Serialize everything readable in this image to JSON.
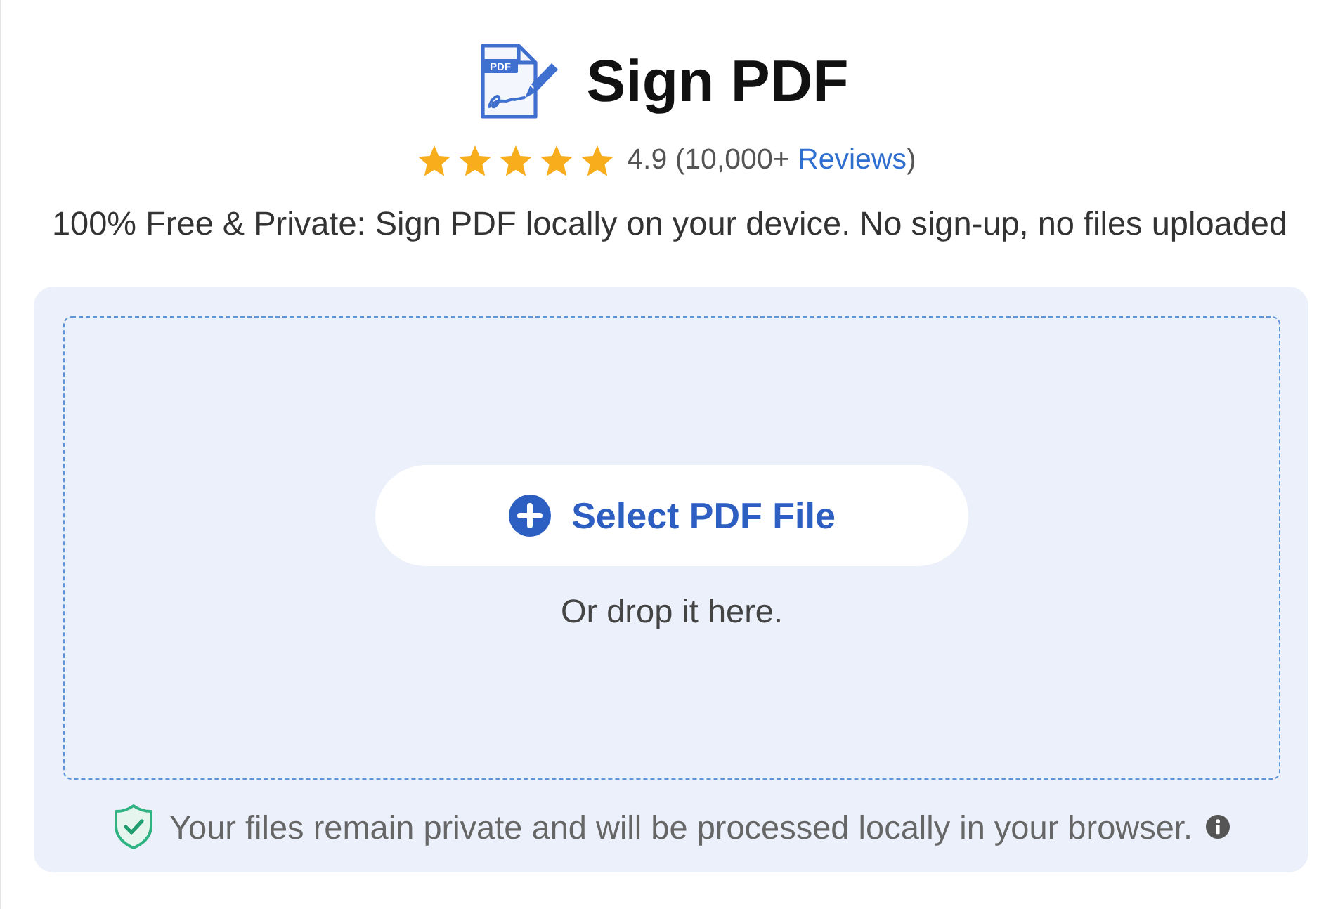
{
  "header": {
    "icon_label": "PDF",
    "title": "Sign PDF"
  },
  "rating": {
    "stars": 5,
    "score": "4.9 (10,000+",
    "link": "Reviews",
    "suffix": ")"
  },
  "tagline": "100% Free & Private: Sign PDF locally on your device. No sign-up, no files uploaded",
  "upload": {
    "button": "Select PDF File",
    "hint": "Or drop it here.",
    "privacy_note": "Your files remain private and will be processed locally in your browser."
  }
}
